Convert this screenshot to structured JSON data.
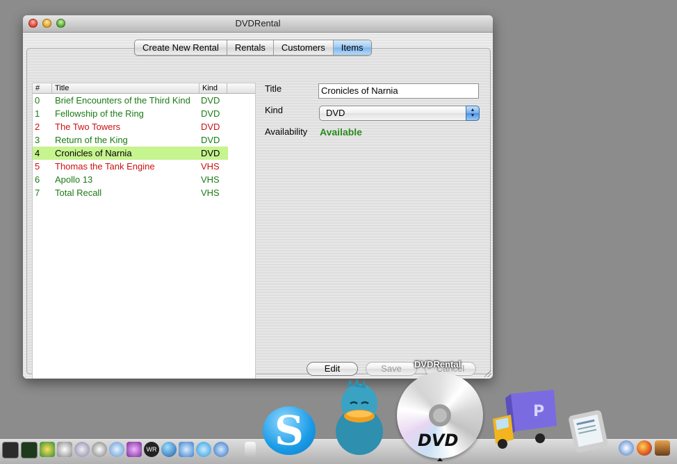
{
  "window": {
    "title": "DVDRental"
  },
  "tabs": [
    {
      "label": "Create New Rental",
      "active": false
    },
    {
      "label": "Rentals",
      "active": false
    },
    {
      "label": "Customers",
      "active": false
    },
    {
      "label": "Items",
      "active": true
    }
  ],
  "table": {
    "columns": [
      "#",
      "Title",
      "Kind"
    ],
    "rows": [
      {
        "num": "0",
        "title": "Brief Encounters of the Third Kind",
        "kind": "DVD",
        "status": "available"
      },
      {
        "num": "1",
        "title": "Fellowship of the Ring",
        "kind": "DVD",
        "status": "available"
      },
      {
        "num": "2",
        "title": "The Two Towers",
        "kind": "DVD",
        "status": "rented"
      },
      {
        "num": "3",
        "title": "Return of the King",
        "kind": "DVD",
        "status": "available"
      },
      {
        "num": "4",
        "title": "Cronicles of Narnia",
        "kind": "DVD",
        "status": "selected"
      },
      {
        "num": "5",
        "title": "Thomas the Tank Engine",
        "kind": "VHS",
        "status": "rented"
      },
      {
        "num": "6",
        "title": "Apollo 13",
        "kind": "VHS",
        "status": "available"
      },
      {
        "num": "7",
        "title": "Total Recall",
        "kind": "VHS",
        "status": "available"
      }
    ]
  },
  "detail": {
    "title_label": "Title",
    "title_value": "Cronicles of Narnia",
    "kind_label": "Kind",
    "kind_value": "DVD",
    "availability_label": "Availability",
    "availability_value": "Available"
  },
  "buttons": {
    "edit": "Edit",
    "save": "Save",
    "cancel": "Cancel"
  },
  "dock": {
    "hover_label": "DVDRental",
    "dvd_logo": "DVD",
    "skype_glyph": "S"
  },
  "colors": {
    "available": "#1a7a14",
    "rented": "#cc1111",
    "selected_row": "#c6f48f",
    "selected_text": "#000000",
    "availability": "#2a8a1e",
    "active_tab": "#8ec1ef"
  },
  "icons": {
    "window_buttons": [
      "close-icon",
      "minimize-icon",
      "zoom-icon"
    ],
    "dock_small": [
      "terminal-icon",
      "activity-monitor-icon",
      "network-icon",
      "stethoscope-icon",
      "disk-utility-icon",
      "sync-icon",
      "mail-icon",
      "itunes-purple-icon",
      "wr-icon",
      "earth-icon",
      "music-icon",
      "skype-small-icon",
      "quicktime-icon",
      "ipod-icon"
    ],
    "dock_large": [
      "skype-icon",
      "adium-duck-icon",
      "dvd-player-icon",
      "transmit-truck-icon",
      "tablet-reader-icon"
    ],
    "dock_right": [
      "safari-icon",
      "firefox-icon",
      "folder-icon"
    ]
  }
}
